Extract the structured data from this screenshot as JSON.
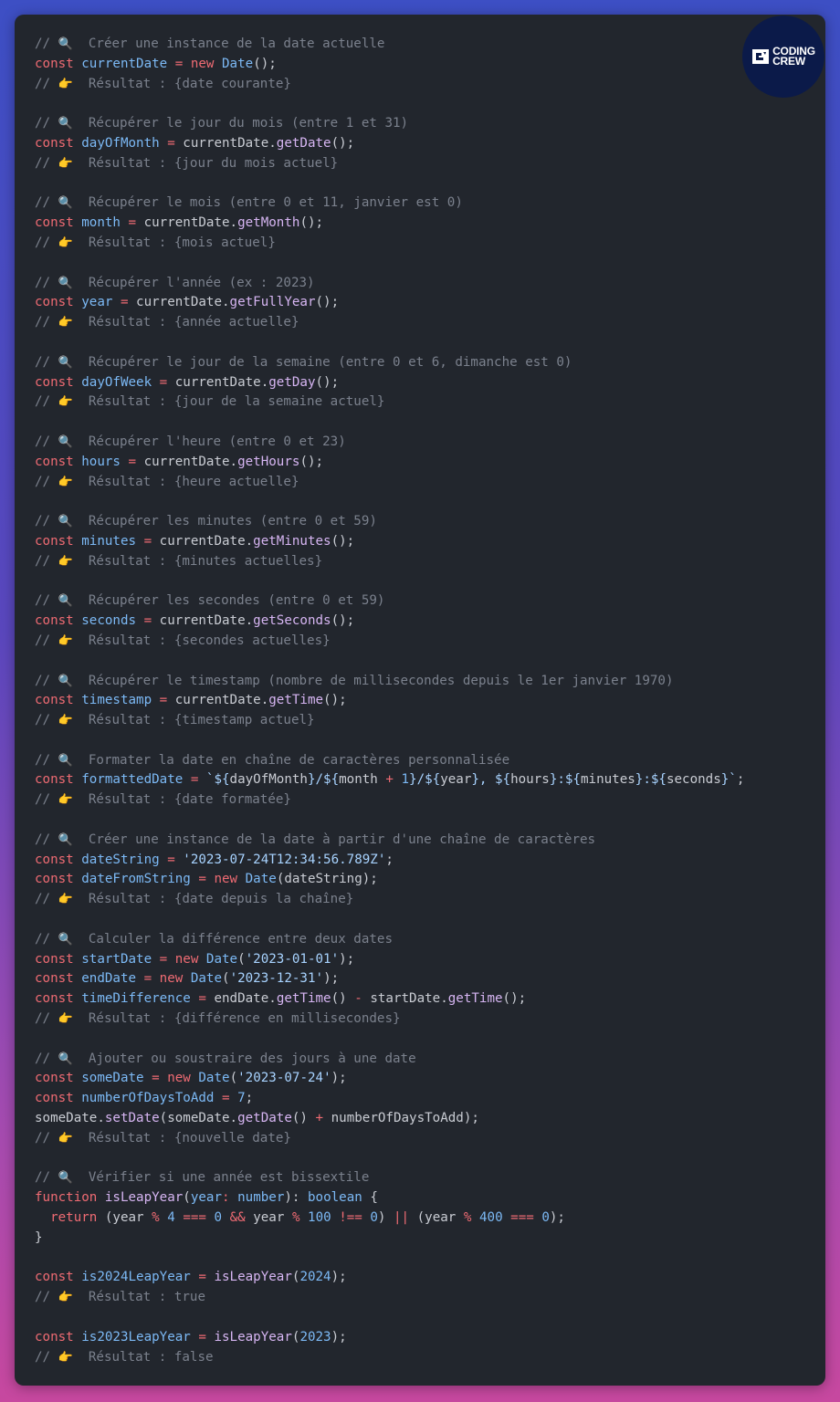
{
  "brand": {
    "line1": "CODING",
    "line2": "CREW"
  },
  "colors": {
    "comment": "#7b818d",
    "keyword": "#ef6b73",
    "variable": "#7cb9f5",
    "function": "#d6b5f2",
    "string": "#a8d3ff",
    "number": "#7cb9f5",
    "plain": "#c9ccd3",
    "editor_bg": "#22262d",
    "badge_bg": "#0b1a49"
  },
  "icons": {
    "magnifier": "magnifier-icon",
    "pointing_hand": "pointing-hand-icon"
  },
  "lines": [
    [
      [
        "cm",
        "// "
      ],
      [
        "emo",
        "🔍"
      ],
      [
        "cm",
        "  Créer une instance de la date actuelle"
      ]
    ],
    [
      [
        "kw",
        "const "
      ],
      [
        "var",
        "currentDate"
      ],
      [
        "op",
        " = "
      ],
      [
        "kw",
        "new "
      ],
      [
        "cls",
        "Date"
      ],
      [
        "pl",
        "();"
      ]
    ],
    [
      [
        "cm",
        "// "
      ],
      [
        "emo",
        "👉"
      ],
      [
        "cm",
        "  Résultat : {date courante}"
      ]
    ],
    [],
    [
      [
        "cm",
        "// "
      ],
      [
        "emo",
        "🔍"
      ],
      [
        "cm",
        "  Récupérer le jour du mois (entre 1 et 31)"
      ]
    ],
    [
      [
        "kw",
        "const "
      ],
      [
        "var",
        "dayOfMonth"
      ],
      [
        "op",
        " = "
      ],
      [
        "pl",
        "currentDate."
      ],
      [
        "fn",
        "getDate"
      ],
      [
        "pl",
        "();"
      ]
    ],
    [
      [
        "cm",
        "// "
      ],
      [
        "emo",
        "👉"
      ],
      [
        "cm",
        "  Résultat : {jour du mois actuel}"
      ]
    ],
    [],
    [
      [
        "cm",
        "// "
      ],
      [
        "emo",
        "🔍"
      ],
      [
        "cm",
        "  Récupérer le mois (entre 0 et 11, janvier est 0)"
      ]
    ],
    [
      [
        "kw",
        "const "
      ],
      [
        "var",
        "month"
      ],
      [
        "op",
        " = "
      ],
      [
        "pl",
        "currentDate."
      ],
      [
        "fn",
        "getMonth"
      ],
      [
        "pl",
        "();"
      ]
    ],
    [
      [
        "cm",
        "// "
      ],
      [
        "emo",
        "👉"
      ],
      [
        "cm",
        "  Résultat : {mois actuel}"
      ]
    ],
    [],
    [
      [
        "cm",
        "// "
      ],
      [
        "emo",
        "🔍"
      ],
      [
        "cm",
        "  Récupérer l'année (ex : 2023)"
      ]
    ],
    [
      [
        "kw",
        "const "
      ],
      [
        "var",
        "year"
      ],
      [
        "op",
        " = "
      ],
      [
        "pl",
        "currentDate."
      ],
      [
        "fn",
        "getFullYear"
      ],
      [
        "pl",
        "();"
      ]
    ],
    [
      [
        "cm",
        "// "
      ],
      [
        "emo",
        "👉"
      ],
      [
        "cm",
        "  Résultat : {année actuelle}"
      ]
    ],
    [],
    [
      [
        "cm",
        "// "
      ],
      [
        "emo",
        "🔍"
      ],
      [
        "cm",
        "  Récupérer le jour de la semaine (entre 0 et 6, dimanche est 0)"
      ]
    ],
    [
      [
        "kw",
        "const "
      ],
      [
        "var",
        "dayOfWeek"
      ],
      [
        "op",
        " = "
      ],
      [
        "pl",
        "currentDate."
      ],
      [
        "fn",
        "getDay"
      ],
      [
        "pl",
        "();"
      ]
    ],
    [
      [
        "cm",
        "// "
      ],
      [
        "emo",
        "👉"
      ],
      [
        "cm",
        "  Résultat : {jour de la semaine actuel}"
      ]
    ],
    [],
    [
      [
        "cm",
        "// "
      ],
      [
        "emo",
        "🔍"
      ],
      [
        "cm",
        "  Récupérer l'heure (entre 0 et 23)"
      ]
    ],
    [
      [
        "kw",
        "const "
      ],
      [
        "var",
        "hours"
      ],
      [
        "op",
        " = "
      ],
      [
        "pl",
        "currentDate."
      ],
      [
        "fn",
        "getHours"
      ],
      [
        "pl",
        "();"
      ]
    ],
    [
      [
        "cm",
        "// "
      ],
      [
        "emo",
        "👉"
      ],
      [
        "cm",
        "  Résultat : {heure actuelle}"
      ]
    ],
    [],
    [
      [
        "cm",
        "// "
      ],
      [
        "emo",
        "🔍"
      ],
      [
        "cm",
        "  Récupérer les minutes (entre 0 et 59)"
      ]
    ],
    [
      [
        "kw",
        "const "
      ],
      [
        "var",
        "minutes"
      ],
      [
        "op",
        " = "
      ],
      [
        "pl",
        "currentDate."
      ],
      [
        "fn",
        "getMinutes"
      ],
      [
        "pl",
        "();"
      ]
    ],
    [
      [
        "cm",
        "// "
      ],
      [
        "emo",
        "👉"
      ],
      [
        "cm",
        "  Résultat : {minutes actuelles}"
      ]
    ],
    [],
    [
      [
        "cm",
        "// "
      ],
      [
        "emo",
        "🔍"
      ],
      [
        "cm",
        "  Récupérer les secondes (entre 0 et 59)"
      ]
    ],
    [
      [
        "kw",
        "const "
      ],
      [
        "var",
        "seconds"
      ],
      [
        "op",
        " = "
      ],
      [
        "pl",
        "currentDate."
      ],
      [
        "fn",
        "getSeconds"
      ],
      [
        "pl",
        "();"
      ]
    ],
    [
      [
        "cm",
        "// "
      ],
      [
        "emo",
        "👉"
      ],
      [
        "cm",
        "  Résultat : {secondes actuelles}"
      ]
    ],
    [],
    [
      [
        "cm",
        "// "
      ],
      [
        "emo",
        "🔍"
      ],
      [
        "cm",
        "  Récupérer le timestamp (nombre de millisecondes depuis le 1er janvier 1970)"
      ]
    ],
    [
      [
        "kw",
        "const "
      ],
      [
        "var",
        "timestamp"
      ],
      [
        "op",
        " = "
      ],
      [
        "pl",
        "currentDate."
      ],
      [
        "fn",
        "getTime"
      ],
      [
        "pl",
        "();"
      ]
    ],
    [
      [
        "cm",
        "// "
      ],
      [
        "emo",
        "👉"
      ],
      [
        "cm",
        "  Résultat : {timestamp actuel}"
      ]
    ],
    [],
    [
      [
        "cm",
        "// "
      ],
      [
        "emo",
        "🔍"
      ],
      [
        "cm",
        "  Formater la date en chaîne de caractères personnalisée"
      ]
    ],
    [
      [
        "kw",
        "const "
      ],
      [
        "var",
        "formattedDate"
      ],
      [
        "op",
        " = "
      ],
      [
        "str",
        "`${"
      ],
      [
        "pl",
        "dayOfMonth"
      ],
      [
        "str",
        "}/${"
      ],
      [
        "pl",
        "month "
      ],
      [
        "op",
        "+ "
      ],
      [
        "num",
        "1"
      ],
      [
        "str",
        "}/${"
      ],
      [
        "pl",
        "year"
      ],
      [
        "str",
        "}, ${"
      ],
      [
        "pl",
        "hours"
      ],
      [
        "str",
        "}:${"
      ],
      [
        "pl",
        "minutes"
      ],
      [
        "str",
        "}:${"
      ],
      [
        "pl",
        "seconds"
      ],
      [
        "str",
        "}`"
      ],
      [
        "pl",
        ";"
      ]
    ],
    [
      [
        "cm",
        "// "
      ],
      [
        "emo",
        "👉"
      ],
      [
        "cm",
        "  Résultat : {date formatée}"
      ]
    ],
    [],
    [
      [
        "cm",
        "// "
      ],
      [
        "emo",
        "🔍"
      ],
      [
        "cm",
        "  Créer une instance de la date à partir d'une chaîne de caractères"
      ]
    ],
    [
      [
        "kw",
        "const "
      ],
      [
        "var",
        "dateString"
      ],
      [
        "op",
        " = "
      ],
      [
        "str",
        "'2023-07-24T12:34:56.789Z'"
      ],
      [
        "pl",
        ";"
      ]
    ],
    [
      [
        "kw",
        "const "
      ],
      [
        "var",
        "dateFromString"
      ],
      [
        "op",
        " = "
      ],
      [
        "kw",
        "new "
      ],
      [
        "cls",
        "Date"
      ],
      [
        "pl",
        "(dateString);"
      ]
    ],
    [
      [
        "cm",
        "// "
      ],
      [
        "emo",
        "👉"
      ],
      [
        "cm",
        "  Résultat : {date depuis la chaîne}"
      ]
    ],
    [],
    [
      [
        "cm",
        "// "
      ],
      [
        "emo",
        "🔍"
      ],
      [
        "cm",
        "  Calculer la différence entre deux dates"
      ]
    ],
    [
      [
        "kw",
        "const "
      ],
      [
        "var",
        "startDate"
      ],
      [
        "op",
        " = "
      ],
      [
        "kw",
        "new "
      ],
      [
        "cls",
        "Date"
      ],
      [
        "pl",
        "("
      ],
      [
        "str",
        "'2023-01-01'"
      ],
      [
        "pl",
        ");"
      ]
    ],
    [
      [
        "kw",
        "const "
      ],
      [
        "var",
        "endDate"
      ],
      [
        "op",
        " = "
      ],
      [
        "kw",
        "new "
      ],
      [
        "cls",
        "Date"
      ],
      [
        "pl",
        "("
      ],
      [
        "str",
        "'2023-12-31'"
      ],
      [
        "pl",
        ");"
      ]
    ],
    [
      [
        "kw",
        "const "
      ],
      [
        "var",
        "timeDifference"
      ],
      [
        "op",
        " = "
      ],
      [
        "pl",
        "endDate."
      ],
      [
        "fn",
        "getTime"
      ],
      [
        "pl",
        "() "
      ],
      [
        "op",
        "- "
      ],
      [
        "pl",
        "startDate."
      ],
      [
        "fn",
        "getTime"
      ],
      [
        "pl",
        "();"
      ]
    ],
    [
      [
        "cm",
        "// "
      ],
      [
        "emo",
        "👉"
      ],
      [
        "cm",
        "  Résultat : {différence en millisecondes}"
      ]
    ],
    [],
    [
      [
        "cm",
        "// "
      ],
      [
        "emo",
        "🔍"
      ],
      [
        "cm",
        "  Ajouter ou soustraire des jours à une date"
      ]
    ],
    [
      [
        "kw",
        "const "
      ],
      [
        "var",
        "someDate"
      ],
      [
        "op",
        " = "
      ],
      [
        "kw",
        "new "
      ],
      [
        "cls",
        "Date"
      ],
      [
        "pl",
        "("
      ],
      [
        "str",
        "'2023-07-24'"
      ],
      [
        "pl",
        ");"
      ]
    ],
    [
      [
        "kw",
        "const "
      ],
      [
        "var",
        "numberOfDaysToAdd"
      ],
      [
        "op",
        " = "
      ],
      [
        "num",
        "7"
      ],
      [
        "pl",
        ";"
      ]
    ],
    [
      [
        "pl",
        "someDate."
      ],
      [
        "fn",
        "setDate"
      ],
      [
        "pl",
        "(someDate."
      ],
      [
        "fn",
        "getDate"
      ],
      [
        "pl",
        "() "
      ],
      [
        "op",
        "+ "
      ],
      [
        "pl",
        "numberOfDaysToAdd);"
      ]
    ],
    [
      [
        "cm",
        "// "
      ],
      [
        "emo",
        "👉"
      ],
      [
        "cm",
        "  Résultat : {nouvelle date}"
      ]
    ],
    [],
    [
      [
        "cm",
        "// "
      ],
      [
        "emo",
        "🔍"
      ],
      [
        "cm",
        "  Vérifier si une année est bissextile"
      ]
    ],
    [
      [
        "kw",
        "function "
      ],
      [
        "fn",
        "isLeapYear"
      ],
      [
        "pl",
        "("
      ],
      [
        "var",
        "year"
      ],
      [
        "op",
        ": "
      ],
      [
        "var",
        "number"
      ],
      [
        "pl",
        "): "
      ],
      [
        "var",
        "boolean"
      ],
      [
        "pl",
        " {"
      ]
    ],
    [
      [
        "pl",
        "  "
      ],
      [
        "kw",
        "return "
      ],
      [
        "pl",
        "(year "
      ],
      [
        "op",
        "% "
      ],
      [
        "num",
        "4 "
      ],
      [
        "op",
        "=== "
      ],
      [
        "num",
        "0 "
      ],
      [
        "op",
        "&& "
      ],
      [
        "pl",
        "year "
      ],
      [
        "op",
        "% "
      ],
      [
        "num",
        "100 "
      ],
      [
        "op",
        "!== "
      ],
      [
        "num",
        "0"
      ],
      [
        "pl",
        ") "
      ],
      [
        "op",
        "|| "
      ],
      [
        "pl",
        "(year "
      ],
      [
        "op",
        "% "
      ],
      [
        "num",
        "400 "
      ],
      [
        "op",
        "=== "
      ],
      [
        "num",
        "0"
      ],
      [
        "pl",
        ");"
      ]
    ],
    [
      [
        "pl",
        "}"
      ]
    ],
    [],
    [
      [
        "kw",
        "const "
      ],
      [
        "var",
        "is2024LeapYear"
      ],
      [
        "op",
        " = "
      ],
      [
        "fn",
        "isLeapYear"
      ],
      [
        "pl",
        "("
      ],
      [
        "num",
        "2024"
      ],
      [
        "pl",
        ");"
      ]
    ],
    [
      [
        "cm",
        "// "
      ],
      [
        "emo",
        "👉"
      ],
      [
        "cm",
        "  Résultat : true"
      ]
    ],
    [],
    [
      [
        "kw",
        "const "
      ],
      [
        "var",
        "is2023LeapYear"
      ],
      [
        "op",
        " = "
      ],
      [
        "fn",
        "isLeapYear"
      ],
      [
        "pl",
        "("
      ],
      [
        "num",
        "2023"
      ],
      [
        "pl",
        ");"
      ]
    ],
    [
      [
        "cm",
        "// "
      ],
      [
        "emo",
        "👉"
      ],
      [
        "cm",
        "  Résultat : false"
      ]
    ]
  ]
}
